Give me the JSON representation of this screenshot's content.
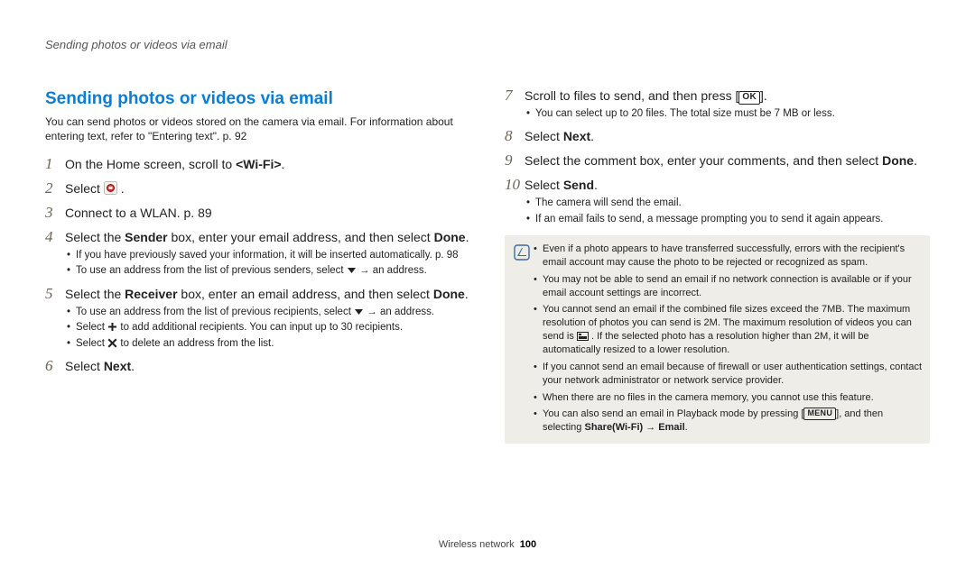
{
  "running_head": "Sending photos or videos via email",
  "title": "Sending photos or videos via email",
  "intro_a": "You can send photos or videos stored on the camera via email. For information about entering text, refer to \"Entering text\". p. 92",
  "left": {
    "s1": {
      "num": "1",
      "a": "On the Home screen, scroll to ",
      "b": "<Wi-Fi>",
      "c": "."
    },
    "s2": {
      "num": "2",
      "a": "Select ",
      "c": "."
    },
    "s3": {
      "num": "3",
      "a": "Connect to a WLAN. p. 89"
    },
    "s4": {
      "num": "4",
      "a": "Select the ",
      "b": "Sender",
      "c": " box, enter your email address, and then select ",
      "d": "Done",
      "e": ".",
      "sub1a": "If you have previously saved your information, it will be inserted automatically. p. 98",
      "sub2a": "To use an address from the list of previous senders, select ",
      "sub2b": " → an address."
    },
    "s5": {
      "num": "5",
      "a": "Select the ",
      "b": "Receiver",
      "c": " box, enter an email address, and then select ",
      "d": "Done",
      "e": ".",
      "sub1a": "To use an address from the list of previous recipients, select ",
      "sub1b": " → an address.",
      "sub2a": "Select ",
      "sub2b": " to add additional recipients. You can input up to 30 recipients.",
      "sub3a": "Select ",
      "sub3b": " to delete an address from the list."
    },
    "s6": {
      "num": "6",
      "a": "Select ",
      "b": "Next",
      "c": "."
    }
  },
  "right": {
    "s7": {
      "num": "7",
      "a": "Scroll to files to send, and then press [",
      "b": "OK",
      "c": "].",
      "sub1": "You can select up to 20 files. The total size must be 7 MB or less."
    },
    "s8": {
      "num": "8",
      "a": "Select ",
      "b": "Next",
      "c": "."
    },
    "s9": {
      "num": "9",
      "a": "Select the comment box, enter your comments, and then select ",
      "b": "Done",
      "c": "."
    },
    "s10": {
      "num": "10",
      "a": "Select ",
      "b": "Send",
      "c": ".",
      "sub1": "The camera will send the email.",
      "sub2": "If an email fails to send, a message prompting you to send it again appears."
    }
  },
  "notes": {
    "n1": "Even if a photo appears to have transferred successfully, errors with the recipient's email account may cause the photo to be rejected or recognized as spam.",
    "n2": "You may not be able to send an email if no network connection is available or if your email account settings are incorrect.",
    "n3a": "You cannot send an email if the combined file sizes exceed the 7MB. The maximum resolution of photos you can send is 2M. The maximum resolution of videos you can send is ",
    "n3b": ". If the selected photo has a resolution higher than 2M, it will be automatically resized to a lower resolution.",
    "n4": "If you cannot send an email because of firewall or user authentication settings, contact your network administrator or network service provider.",
    "n5": "When there are no files in the camera memory, you cannot use this feature.",
    "n6a": "You can also send an email in Playback mode by pressing [",
    "n6b": "MENU",
    "n6c": "], and then selecting ",
    "n6d": "Share(Wi-Fi)",
    "n6e": " → ",
    "n6f": "Email",
    "n6g": "."
  },
  "footer": {
    "a": "Wireless network",
    "b": "100"
  }
}
